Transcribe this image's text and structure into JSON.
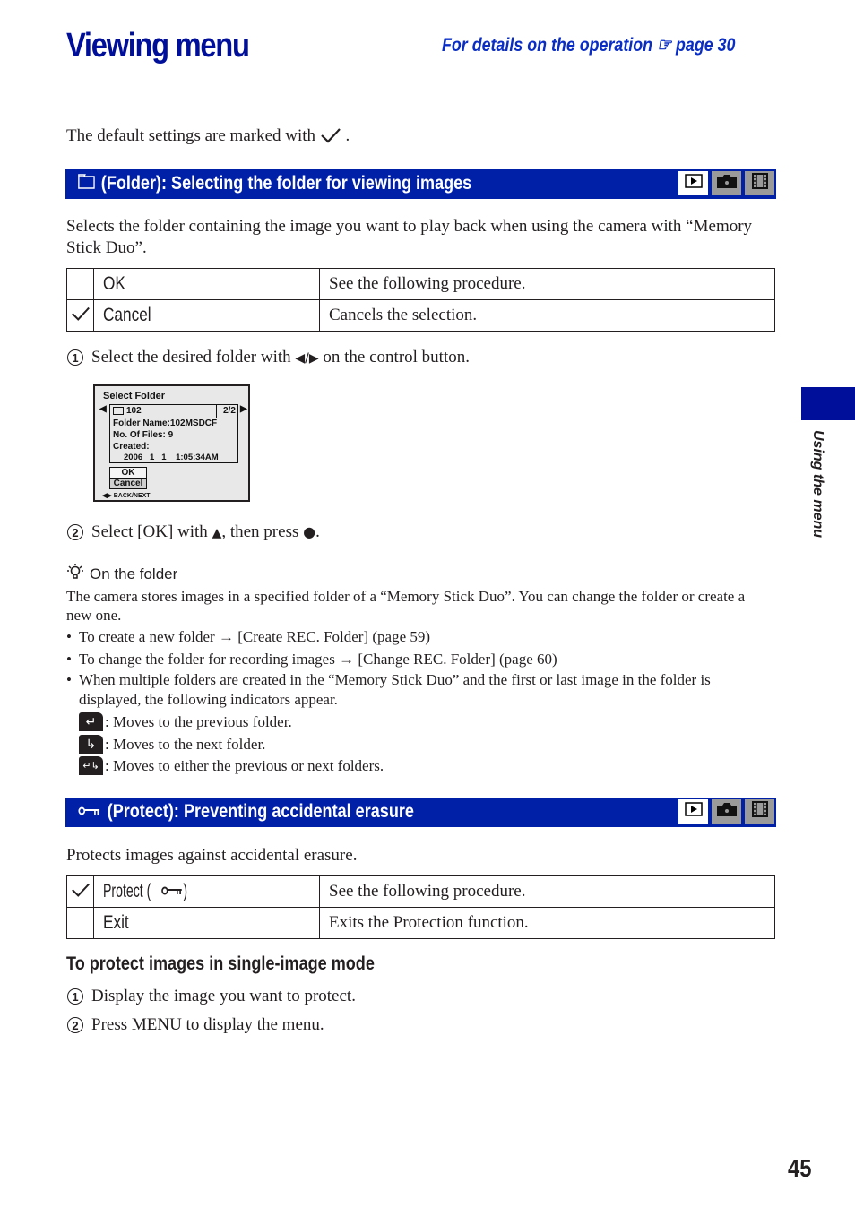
{
  "header": {
    "title": "Viewing menu",
    "reference_text": "For details on the operation",
    "reference_icon": "pointing-hand-icon",
    "reference_page": "page 30"
  },
  "intro": {
    "text": "The default settings are marked with",
    "icon": "checkmark-icon",
    "suffix": "."
  },
  "folder_section": {
    "icon": "folder-icon",
    "heading": "(Folder): Selecting the folder for viewing images",
    "modes": [
      {
        "name": "playback",
        "icon": "play-icon",
        "active": true
      },
      {
        "name": "still",
        "icon": "camera-icon",
        "active": false
      },
      {
        "name": "movie",
        "icon": "film-icon",
        "active": false
      }
    ],
    "description": "Selects the folder containing the image you want to play back when using the camera with “Memory Stick Duo”.",
    "options": [
      {
        "default": false,
        "name": "OK",
        "description": "See the following procedure."
      },
      {
        "default": true,
        "name": "Cancel",
        "description": "Cancels the selection."
      }
    ],
    "steps": [
      {
        "number": "1",
        "text_a": "Select the desired folder with",
        "symbol": "◀/▶",
        "text_b": "on the control button."
      },
      {
        "number": "2",
        "text_a": "Select [OK] with",
        "symbol": "▲",
        "text_b": ", then press",
        "symbol2": "●",
        "text_c": "."
      }
    ],
    "screen": {
      "title": "Select Folder",
      "folder_number": "102",
      "folder_index": "2/2",
      "folder_name": "Folder Name:102MSDCF",
      "files": "No. Of Files:  9",
      "created_label": "Created:",
      "created_value": "2006   1   1    1:05:34AM",
      "ok": "OK",
      "cancel": "Cancel",
      "footer": "BACK/NEXT"
    },
    "hint": {
      "icon": "lightbulb-icon",
      "heading": "On the folder",
      "text": "The camera stores images in a specified folder of a “Memory Stick Duo”. You can change the folder or create a new one.",
      "bullets": [
        {
          "text": "To create a new folder",
          "arrow": "→",
          "target": "[Create REC. Folder] (page 59)"
        },
        {
          "text": "To change the folder for recording images",
          "arrow": "→",
          "target": "[Change REC. Folder] (page 60)"
        }
      ],
      "bullet3_line1": "When multiple folders are created in the “Memory Stick Duo” and the first or last image in the folder is",
      "bullet3_line2": "displayed, the following indicators appear.",
      "indicators": [
        {
          "icon": "previous-folder-icon",
          "glyph": "↵",
          "text": ": Moves to the previous folder."
        },
        {
          "icon": "next-folder-icon",
          "glyph": "↳",
          "text": ": Moves to the next folder."
        },
        {
          "icon": "prev-next-folder-icon",
          "glyph": "↵↳",
          "text": ": Moves to either the previous or next folders."
        }
      ]
    }
  },
  "protect_section": {
    "icon": "key-icon",
    "heading": "(Protect): Preventing accidental erasure",
    "description": "Protects images against accidental erasure.",
    "options": [
      {
        "default": true,
        "name": "Protect (",
        "name_icon": "key-icon",
        "name_suffix": ")",
        "description": "See the following procedure."
      },
      {
        "default": false,
        "name": "Exit",
        "description": "Exits the Protection function."
      }
    ],
    "subheading": "To protect images in single-image mode",
    "steps": [
      {
        "number": "1",
        "text": "Display the image you want to protect."
      },
      {
        "number": "2",
        "text": "Press MENU to display the menu."
      }
    ]
  },
  "sidebar": {
    "label": "Using the menu",
    "accent": "#000f9a"
  },
  "page_number": "45",
  "colors": {
    "title": "#000f9a",
    "bar": "#0020a8",
    "reference": "#0a2ec4"
  }
}
